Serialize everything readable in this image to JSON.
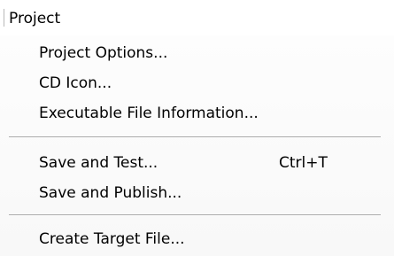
{
  "menu": {
    "title": "Project",
    "items": [
      {
        "label": "Project Options...",
        "shortcut": ""
      },
      {
        "label": "CD Icon...",
        "shortcut": ""
      },
      {
        "label": "Executable File Information...",
        "shortcut": ""
      },
      {
        "label": "Save and Test...",
        "shortcut": "Ctrl+T"
      },
      {
        "label": "Save and Publish...",
        "shortcut": ""
      },
      {
        "label": "Create Target File...",
        "shortcut": ""
      }
    ]
  }
}
